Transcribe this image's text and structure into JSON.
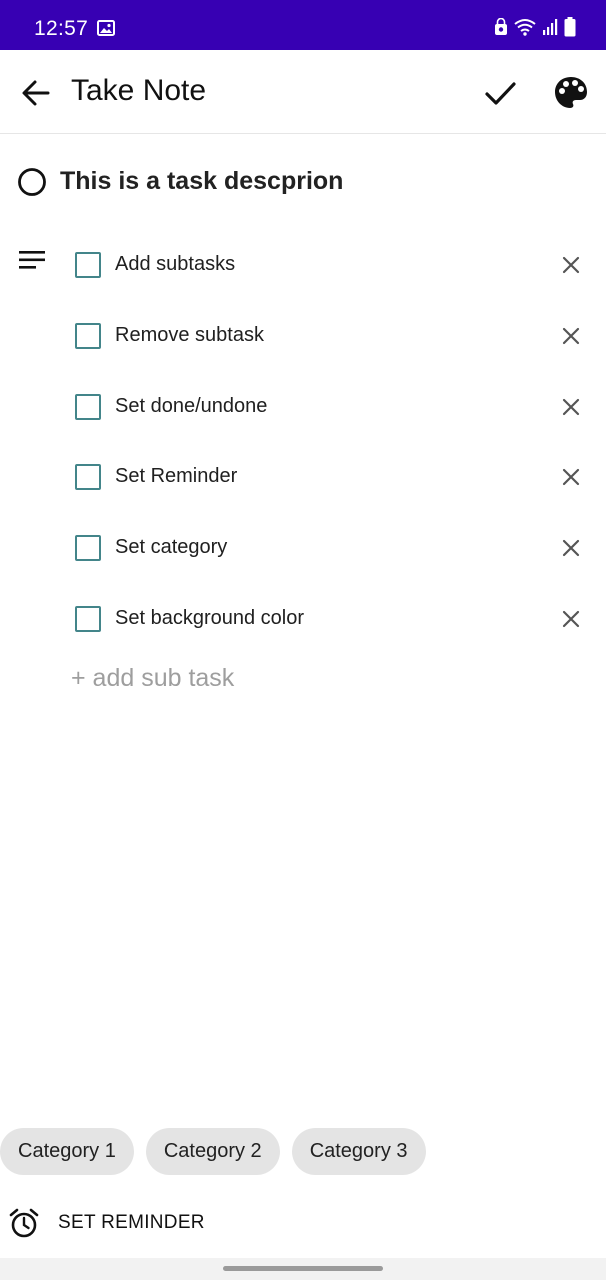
{
  "status_bar": {
    "time": "12:57",
    "icons": [
      "image-icon",
      "alarm-lock-icon",
      "wifi-icon",
      "signal-icon",
      "battery-icon"
    ],
    "background": "#3700b3"
  },
  "app_bar": {
    "title": "Take Note",
    "back_icon": "arrow-left-icon",
    "save_icon": "check-icon",
    "palette_icon": "palette-icon"
  },
  "task": {
    "title": "This is a task descprion",
    "radio_state": "unchecked"
  },
  "subtasks": [
    {
      "label": "Add subtasks",
      "checked": false
    },
    {
      "label": "Remove subtask",
      "checked": false
    },
    {
      "label": "Set done/undone",
      "checked": false
    },
    {
      "label": "Set Reminder",
      "checked": false
    },
    {
      "label": "Set category",
      "checked": false
    },
    {
      "label": "Set background color",
      "checked": false
    }
  ],
  "add_subtask_label": "+ add sub task",
  "categories": [
    "Category 1",
    "Category 2",
    "Category 3"
  ],
  "reminder": {
    "label": "SET REMINDER",
    "icon": "alarm-clock-icon"
  },
  "colors": {
    "accent": "#3700b3",
    "checkbox": "#43858a",
    "chip": "#e4e4e4"
  }
}
